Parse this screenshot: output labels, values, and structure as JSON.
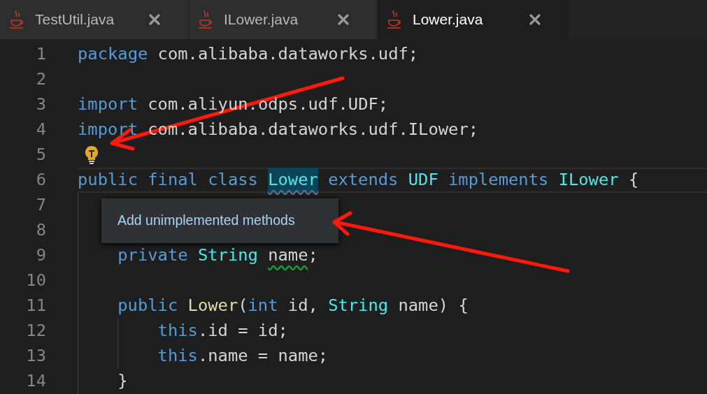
{
  "tabs": [
    {
      "label": "TestUtil.java",
      "selected": false
    },
    {
      "label": "ILower.java",
      "selected": false
    },
    {
      "label": "Lower.java",
      "selected": true
    }
  ],
  "lines": [
    {
      "number": "1",
      "tokens": [
        {
          "text": "package",
          "kind": "keyword"
        },
        {
          "text": "com.alibaba.dataworks.udf;",
          "kind": "plain"
        }
      ]
    },
    {
      "number": "2"
    },
    {
      "number": "3",
      "tokens": [
        {
          "text": "import",
          "kind": "keyword"
        },
        {
          "text": "com.aliyun.odps.udf.UDF;",
          "kind": "plain"
        }
      ]
    },
    {
      "number": "4",
      "tokens": [
        {
          "text": "import",
          "kind": "keyword"
        },
        {
          "text": "com.alibaba.dataworks.udf.ILower;",
          "kind": "plain"
        }
      ]
    },
    {
      "number": "5",
      "lightbulb": true
    },
    {
      "number": "6",
      "current": true,
      "tokens": [
        {
          "text": "public",
          "kind": "keyword"
        },
        {
          "text": "final",
          "kind": "keyword"
        },
        {
          "text": "class",
          "kind": "keyword"
        },
        {
          "text": "Lower",
          "kind": "type",
          "highlighted": true,
          "info_squiggle": true
        },
        {
          "text": "extends",
          "kind": "keyword"
        },
        {
          "text": "UDF",
          "kind": "type"
        },
        {
          "text": "implements",
          "kind": "keyword"
        },
        {
          "text": "ILower",
          "kind": "type"
        },
        {
          "text": "{",
          "kind": "plain"
        }
      ],
      "children": [
        {
          "number": "7"
        },
        {
          "number": "8"
        },
        {
          "number": "9",
          "tokens": [
            {
              "text": "private",
              "kind": "keyword"
            },
            {
              "text": "String",
              "kind": "type"
            },
            {
              "text": "name",
              "kind": "plain",
              "hint_squiggle": true
            },
            {
              "text": ";",
              "kind": "plain",
              "joined": true
            }
          ]
        },
        {
          "number": "10"
        },
        {
          "number": "11",
          "tokens": [
            {
              "text": "public",
              "kind": "keyword"
            },
            {
              "text": "Lower",
              "kind": "function"
            },
            {
              "text": "(",
              "kind": "plain",
              "joined": true
            },
            {
              "text": "int",
              "kind": "keyword",
              "joined": true
            },
            {
              "text": "id,",
              "kind": "plain"
            },
            {
              "text": "String",
              "kind": "type"
            },
            {
              "text": "name) {",
              "kind": "plain"
            }
          ],
          "children": [
            {
              "number": "12",
              "tokens": [
                {
                  "text": "this",
                  "kind": "keyword"
                },
                {
                  "text": ".id = id;",
                  "kind": "plain",
                  "joined": true
                }
              ]
            },
            {
              "number": "13",
              "tokens": [
                {
                  "text": "this",
                  "kind": "keyword"
                },
                {
                  "text": ".name = name;",
                  "kind": "plain",
                  "joined": true
                }
              ]
            }
          ]
        },
        {
          "number": "14",
          "tokens": [
            {
              "text": "}",
              "kind": "plain"
            }
          ]
        }
      ]
    }
  ],
  "quick_fix": {
    "label": "Add unimplemented methods"
  }
}
